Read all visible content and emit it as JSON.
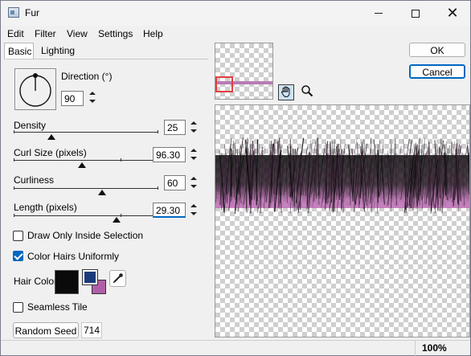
{
  "window": {
    "title": "Fur",
    "close_glyph": "✕"
  },
  "menu": [
    "Edit",
    "Filter",
    "View",
    "Settings",
    "Help"
  ],
  "tabs": [
    "Basic",
    "Lighting"
  ],
  "basic": {
    "direction_label": "Direction (°)",
    "direction_value": "90",
    "density_label": "Density",
    "density_value": "25",
    "density_level": 0.25,
    "curl_label": "Curl Size (pixels)",
    "curl_value": "96.30",
    "curliness_label": "Curliness",
    "curliness_value": "60",
    "length_label": "Length (pixels)",
    "length_value": "29.30",
    "draw_only_label": "Draw Only Inside Selection",
    "draw_only_checked": false,
    "color_uniform_label": "Color Hairs Uniformly",
    "color_uniform_checked": true,
    "hair_color_label": "Hair Color",
    "hair_color": "#0a0a0a",
    "fore_color": "#1a3a7a",
    "back_color": "#b060a8",
    "seamless_label": "Seamless Tile",
    "seamless_checked": false,
    "random_seed_label": "Random Seed",
    "random_seed_value": "714"
  },
  "buttons": {
    "ok": "OK",
    "cancel": "Cancel"
  },
  "status": {
    "zoom": "100%"
  },
  "icons": {
    "app": "fur-app-icon",
    "hand": "hand-pan-icon",
    "zoom": "magnifier-icon",
    "eyedropper": "eyedropper-icon"
  },
  "colors": {
    "fur_tip": "#c070b8",
    "fur_root": "#0c0c0c",
    "accent": "#0067c0"
  }
}
